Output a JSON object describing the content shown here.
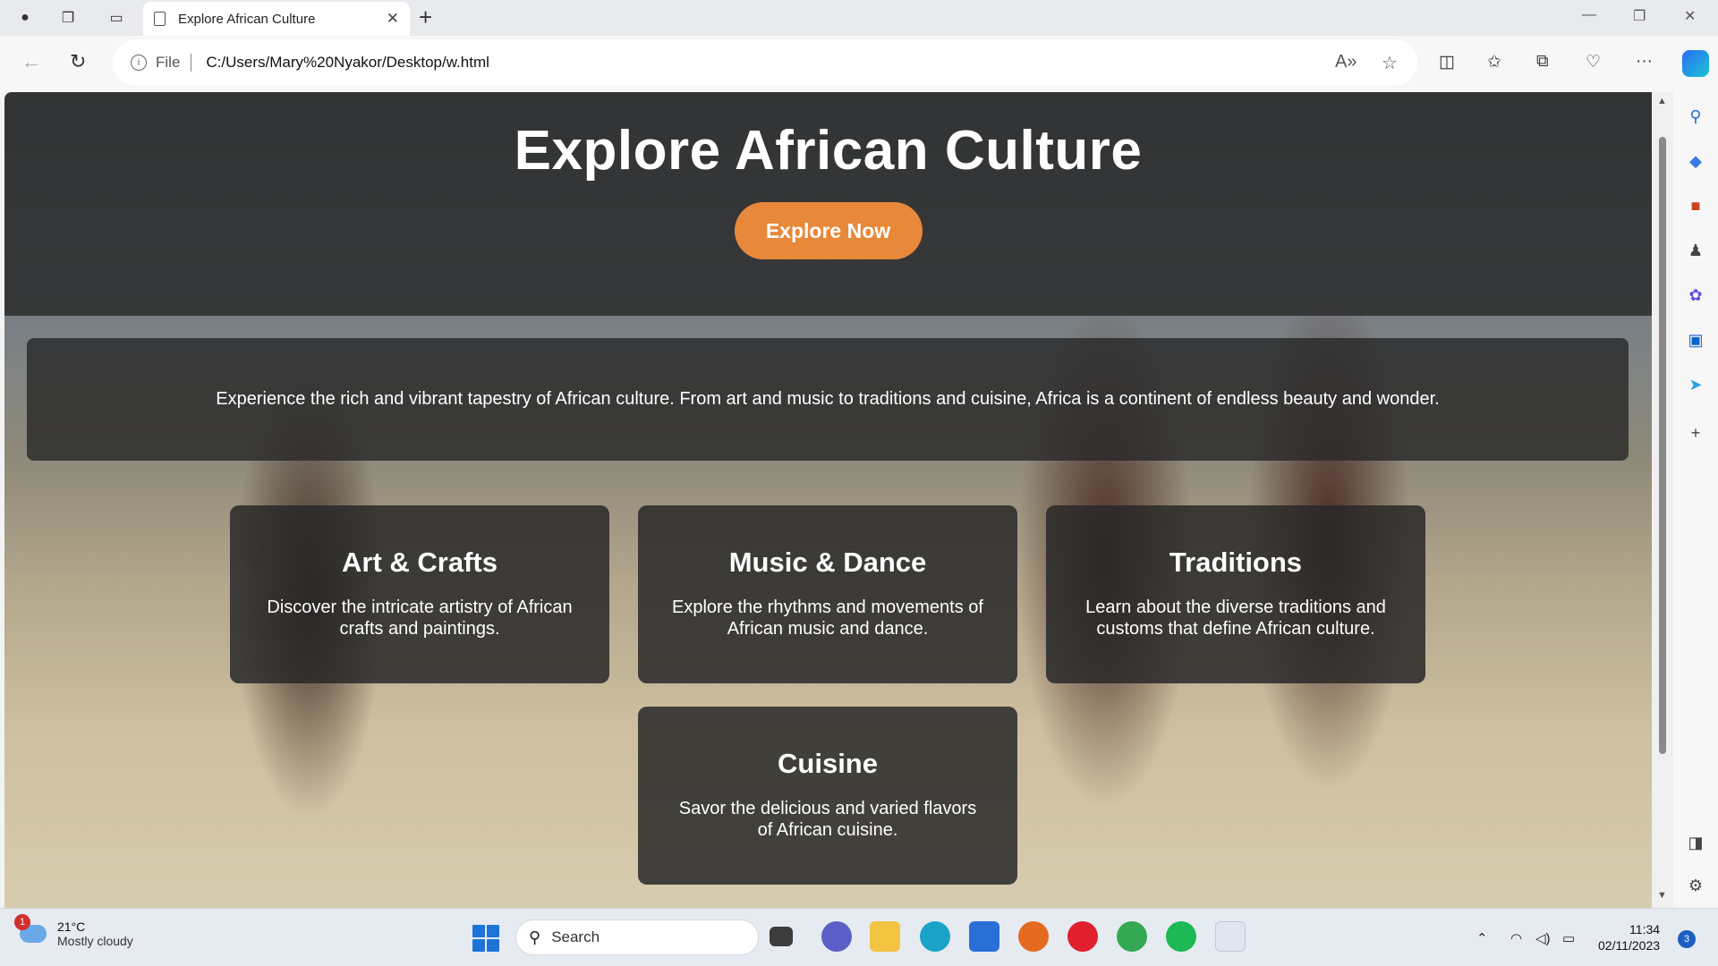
{
  "browser": {
    "tab_title": "Explore African Culture",
    "address": {
      "scheme_label": "File",
      "url": "C:/Users/Mary%20Nyakor/Desktop/w.html"
    }
  },
  "page": {
    "hero_title": "Explore African Culture",
    "cta_label": "Explore Now",
    "intro": "Experience the rich and vibrant tapestry of African culture. From art and music to traditions and cuisine, Africa is a continent of endless beauty and wonder.",
    "cards": [
      {
        "title": "Art & Crafts",
        "text": "Discover the intricate artistry of African crafts and paintings."
      },
      {
        "title": "Music & Dance",
        "text": "Explore the rhythms and movements of African music and dance."
      },
      {
        "title": "Traditions",
        "text": "Learn about the diverse traditions and customs that define African culture."
      },
      {
        "title": "Cuisine",
        "text": "Savor the delicious and varied flavors of African cuisine."
      }
    ]
  },
  "taskbar": {
    "weather": {
      "badge": "1",
      "temp": "21°C",
      "desc": "Mostly cloudy"
    },
    "search_label": "Search",
    "clock": {
      "time": "11:34",
      "date": "02/11/2023"
    },
    "notification_count": "3"
  },
  "colors": {
    "accent": "#e8883a",
    "overlay": "#282828",
    "edge_blue": "#1e73d8"
  }
}
